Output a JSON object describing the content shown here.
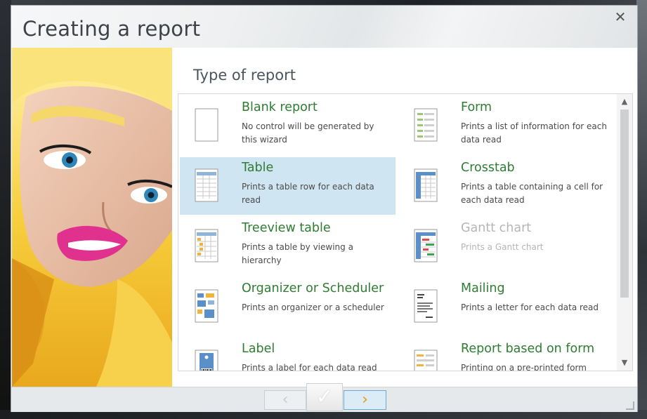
{
  "window": {
    "title": "Creating a report",
    "close_glyph": "✕"
  },
  "main": {
    "section_title": "Type of report"
  },
  "report_types": [
    {
      "name": "Blank report",
      "desc": "No control will be generated by this wizard",
      "icon": "blank-page-icon",
      "state": "normal"
    },
    {
      "name": "Form",
      "desc": "Prints a list of information for each data read",
      "icon": "form-icon",
      "state": "normal"
    },
    {
      "name": "Table",
      "desc": "Prints a table row for each data read",
      "icon": "table-icon",
      "state": "selected"
    },
    {
      "name": "Crosstab",
      "desc": "Prints a table containing a cell for each data read",
      "icon": "crosstab-icon",
      "state": "normal"
    },
    {
      "name": "Treeview table",
      "desc": "Prints a table by viewing a hierarchy",
      "icon": "treeview-table-icon",
      "state": "normal"
    },
    {
      "name": "Gantt chart",
      "desc": "Prints a Gantt chart",
      "icon": "gantt-chart-icon",
      "state": "disabled"
    },
    {
      "name": "Organizer or Scheduler",
      "desc": "Prints an organizer or a scheduler",
      "icon": "organizer-icon",
      "state": "normal"
    },
    {
      "name": "Mailing",
      "desc": "Prints a letter for each data read",
      "icon": "mailing-icon",
      "state": "normal"
    },
    {
      "name": "Label",
      "desc": "Prints a label for each data read",
      "icon": "label-icon",
      "state": "normal"
    },
    {
      "name": "Report based on form",
      "desc": "Printing on a pre-printed form",
      "icon": "preprinted-form-icon",
      "state": "normal"
    }
  ],
  "footer": {
    "prev_glyph": "‹",
    "finish_glyph": "✓",
    "next_glyph": "›"
  },
  "scrollbar": {
    "up_glyph": "▲",
    "down_glyph": "▼"
  },
  "colors": {
    "accent_green": "#2e7d32",
    "selection": "#cfe5f2",
    "next_arrow": "#e39b1c"
  }
}
